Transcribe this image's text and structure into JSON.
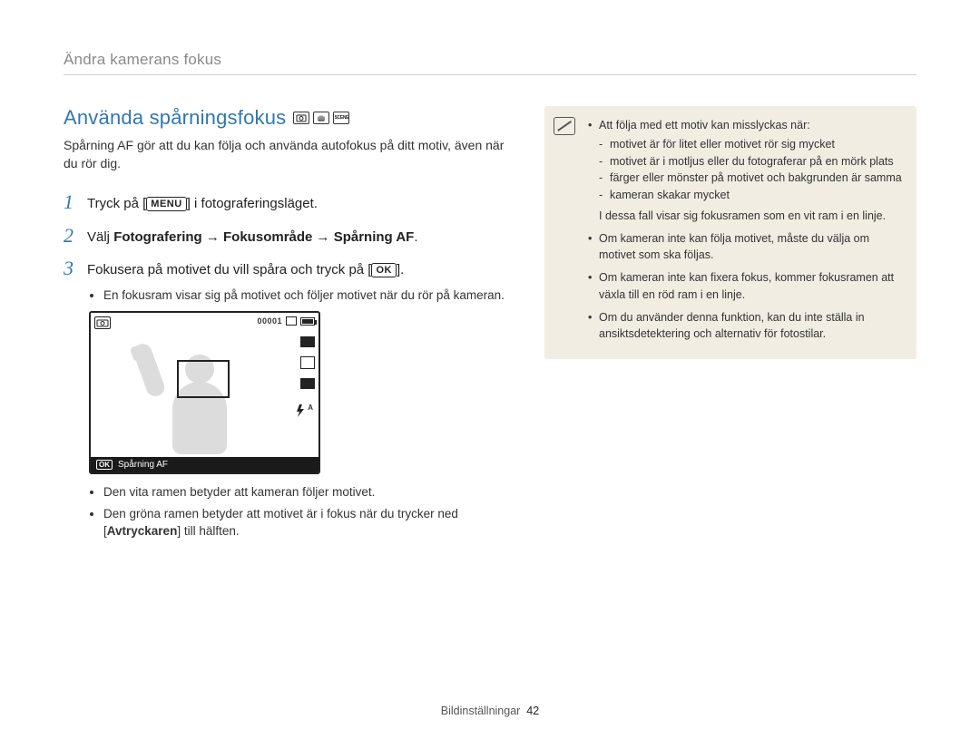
{
  "breadcrumb": "Ändra kamerans fokus",
  "section": {
    "title": "Använda spårningsfokus",
    "mode_icons": [
      "P",
      "hand",
      "SCENE"
    ],
    "intro": "Spårning AF gör att du kan följa och använda autofokus på ditt motiv, även när du rör dig."
  },
  "steps": [
    {
      "num": "1",
      "before": "Tryck på [",
      "pill": "MENU",
      "after": "] i fotograferingsläget."
    },
    {
      "num": "2",
      "before": "Välj ",
      "bold": "Fotografering → Fokusområde → Spårning AF",
      "after": "."
    },
    {
      "num": "3",
      "before": "Fokusera på motivet du vill spåra och tryck på [",
      "pill": "OK",
      "after": "]."
    }
  ],
  "step3_bullets": [
    "En fokusram visar sig på motivet och följer motivet när du rör på kameran."
  ],
  "lcd": {
    "counter": "00001",
    "bottom_pill": "OK",
    "bottom_label": "Spårning AF"
  },
  "after_lcd_bullets": [
    {
      "text": "Den vita ramen betyder att kameran följer motivet."
    },
    {
      "before": "Den gröna ramen betyder att motivet är i fokus när du trycker ned [",
      "bold": "Avtryckaren",
      "after": "] till hälften."
    }
  ],
  "note": {
    "lead": "Att följa med ett motiv kan misslyckas när:",
    "fail_reasons": [
      "motivet är för litet eller motivet rör sig mycket",
      "motivet är i motljus eller du fotograferar på en mörk plats",
      "färger eller mönster på motivet och bakgrunden är samma",
      "kameran skakar mycket"
    ],
    "fail_tail": "I dessa fall visar sig fokusramen som en vit ram i en linje.",
    "extra": [
      "Om kameran inte kan följa motivet, måste du välja om motivet som ska följas.",
      "Om kameran inte kan fixera fokus, kommer fokusramen att växla till en röd ram i en linje.",
      "Om du använder denna funktion, kan du inte ställa in ansiktsdetektering och alternativ för fotostilar."
    ]
  },
  "footer": {
    "section": "Bildinställningar",
    "page": "42"
  }
}
